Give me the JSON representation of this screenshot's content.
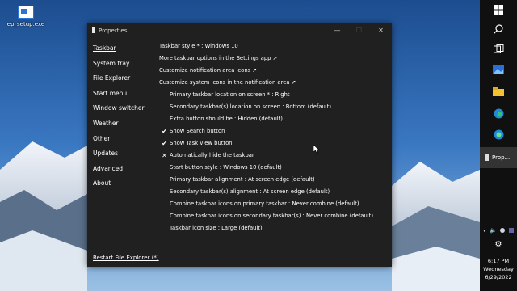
{
  "desktop": {
    "icon_label": "ep_setup.exe"
  },
  "window": {
    "title": "Properties",
    "controls": {
      "minimize": "—",
      "maximize": "☐",
      "close": "✕"
    }
  },
  "sidebar": {
    "items": [
      {
        "label": "Taskbar"
      },
      {
        "label": "System tray"
      },
      {
        "label": "File Explorer"
      },
      {
        "label": "Start menu"
      },
      {
        "label": "Window switcher"
      },
      {
        "label": "Weather"
      },
      {
        "label": "Other"
      },
      {
        "label": "Updates"
      },
      {
        "label": "Advanced"
      },
      {
        "label": "About"
      }
    ],
    "restart_link": "Restart File Explorer (*)"
  },
  "settings": [
    {
      "text": "Taskbar style * : Windows 10",
      "mark": "",
      "indent": false
    },
    {
      "text": "More taskbar options in the Settings app ↗",
      "mark": "",
      "indent": false
    },
    {
      "text": "Customize notification area icons ↗",
      "mark": "",
      "indent": false
    },
    {
      "text": "Customize system icons in the notification area ↗",
      "mark": "",
      "indent": false
    },
    {
      "text": "Primary taskbar location on screen * : Right",
      "mark": "",
      "indent": true
    },
    {
      "text": "Secondary taskbar(s) location on screen : Bottom (default)",
      "mark": "",
      "indent": true
    },
    {
      "text": "Extra button should be : Hidden (default)",
      "mark": "",
      "indent": true
    },
    {
      "text": "Show Search button",
      "mark": "✔",
      "indent": true
    },
    {
      "text": "Show Task view button",
      "mark": "✔",
      "indent": true
    },
    {
      "text": "Automatically hide the taskbar",
      "mark": "✕",
      "indent": true
    },
    {
      "text": "Start button style : Windows 10 (default)",
      "mark": "",
      "indent": true
    },
    {
      "text": "Primary taskbar alignment : At screen edge (default)",
      "mark": "",
      "indent": true
    },
    {
      "text": "Secondary taskbar(s) alignment : At screen edge (default)",
      "mark": "",
      "indent": true
    },
    {
      "text": "Combine taskbar icons on primary taskbar : Never combine (default)",
      "mark": "",
      "indent": true
    },
    {
      "text": "Combine taskbar icons on secondary taskbar(s) : Never combine (default)",
      "mark": "",
      "indent": true
    },
    {
      "text": "Taskbar icon size : Large (default)",
      "mark": "",
      "indent": true
    }
  ],
  "taskbar": {
    "prop_label": "Prop...",
    "icons": [
      "start-icon",
      "search-icon",
      "task-view-icon",
      "photos-icon",
      "file-explorer-icon",
      "edge-icon",
      "edge-beta-icon"
    ]
  },
  "tray": {
    "icons": [
      "chevron-left-icon",
      "volume-icon",
      "cloud-icon",
      "teams-icon",
      "settings-gear-icon"
    ]
  },
  "clock": {
    "time": "6:17 PM",
    "day": "Wednesday",
    "date": "6/29/2022"
  },
  "colors": {
    "window_bg": "#202020",
    "taskbar_bg": "#101010",
    "accent": "#2a72d8"
  }
}
